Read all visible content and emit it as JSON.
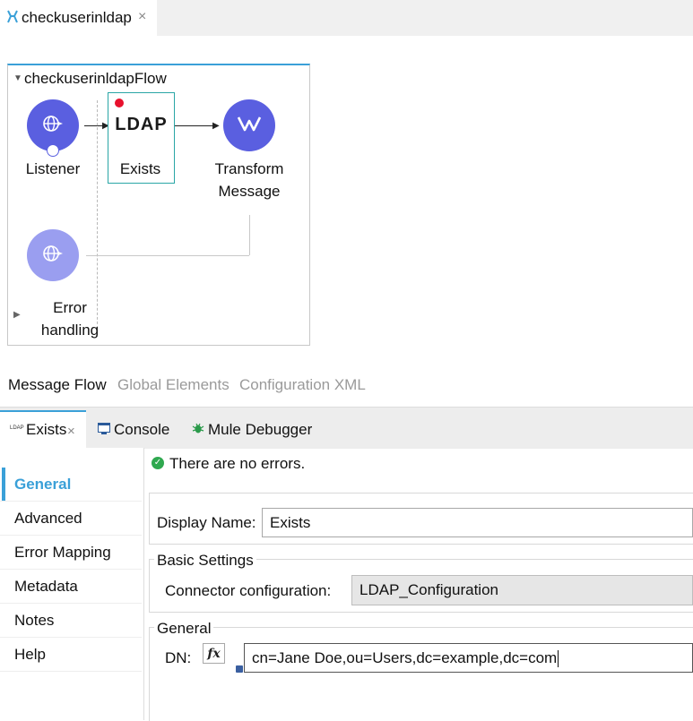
{
  "editor": {
    "tab_title": "checkuserinldap",
    "close_glyph": "×"
  },
  "flow": {
    "name": "checkuserinldapFlow",
    "nodes": {
      "listener": "Listener",
      "ldap_icon_text": "LDAP",
      "ldap_label": "Exists",
      "transform_line1": "Transform",
      "transform_line2": "Message",
      "error_line1": "Error",
      "error_line2": "handling"
    }
  },
  "view_tabs": [
    "Message Flow",
    "Global Elements",
    "Configuration XML"
  ],
  "panel_tabs": {
    "exists": "Exists",
    "exists_icon_text": "LDAP",
    "console": "Console",
    "debugger": "Mule Debugger"
  },
  "sidenav": [
    "General",
    "Advanced",
    "Error Mapping",
    "Metadata",
    "Notes",
    "Help"
  ],
  "status": {
    "message": "There are no errors."
  },
  "form": {
    "display_name_label": "Display Name:",
    "display_name_value": "Exists",
    "basic_settings_title": "Basic Settings",
    "connector_label": "Connector configuration:",
    "connector_value": "LDAP_Configuration",
    "general_title": "General",
    "dn_label": "DN:",
    "fx_label": "fx",
    "dn_value": "cn=Jane Doe,ou=Users,dc=example,dc=com"
  },
  "colors": {
    "accent": "#3aa0d8",
    "node": "#5a5fe0",
    "node_light": "#9a9ef0",
    "ldap_border": "#2aa6a6",
    "breakpoint": "#e8112d",
    "ok": "#2fa84f"
  }
}
